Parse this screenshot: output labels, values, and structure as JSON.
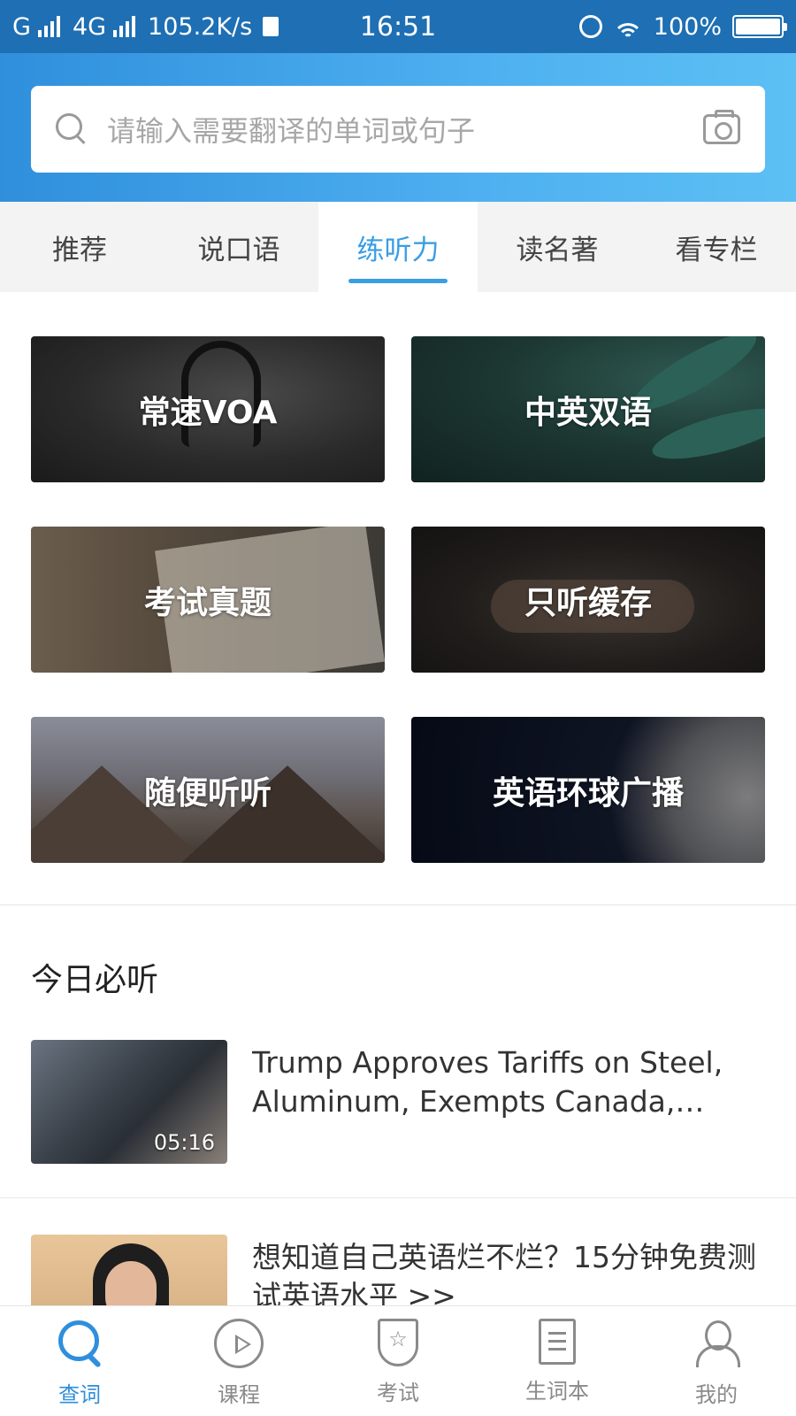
{
  "status_bar": {
    "carrier1": "G",
    "carrier2": "4G",
    "speed": "105.2K/s",
    "time": "16:51",
    "battery": "100%",
    "battery_level": 1.0
  },
  "search": {
    "placeholder": "请输入需要翻译的单词或句子"
  },
  "tabs": [
    {
      "label": "推荐",
      "active": false
    },
    {
      "label": "说口语",
      "active": false
    },
    {
      "label": "练听力",
      "active": true
    },
    {
      "label": "读名著",
      "active": false
    },
    {
      "label": "看专栏",
      "active": false
    }
  ],
  "categories": [
    {
      "label": "常速VOA"
    },
    {
      "label": "中英双语"
    },
    {
      "label": "考试真题"
    },
    {
      "label": "只听缓存"
    },
    {
      "label": "随便听听"
    },
    {
      "label": "英语环球广播"
    }
  ],
  "section": {
    "title": "今日必听"
  },
  "list": [
    {
      "title": "Trump Approves Tariffs on Steel, Aluminum, Exempts Canada,…",
      "duration": "05:16"
    },
    {
      "title": "想知道自己英语烂不烂？15分钟免费测试英语水平 >>"
    }
  ],
  "bottom_nav": [
    {
      "label": "查词",
      "icon": "search-icon",
      "active": true
    },
    {
      "label": "课程",
      "icon": "play-circle-icon",
      "active": false
    },
    {
      "label": "考试",
      "icon": "badge-star-icon",
      "active": false
    },
    {
      "label": "生词本",
      "icon": "notebook-icon",
      "active": false
    },
    {
      "label": "我的",
      "icon": "user-icon",
      "active": false
    }
  ],
  "colors": {
    "accent": "#3a9ee4",
    "header_start": "#2f8fdc",
    "header_end": "#5cc0f4",
    "status_bar": "#1e6fb3"
  }
}
